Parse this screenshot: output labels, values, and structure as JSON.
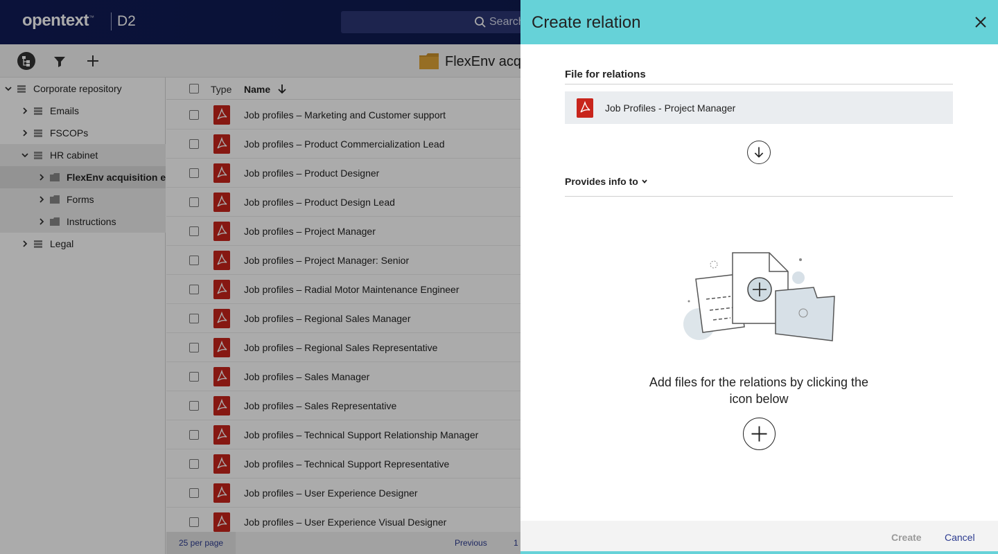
{
  "header": {
    "brand": "opentext",
    "brand_tm": "™",
    "product": "D2",
    "search_placeholder": "Search"
  },
  "toolbar": {
    "current_folder": "FlexEnv acq"
  },
  "sidebar": {
    "items": [
      {
        "label": "Corporate repository"
      },
      {
        "label": "Emails"
      },
      {
        "label": "FSCOPs"
      },
      {
        "label": "HR cabinet"
      },
      {
        "label": "FlexEnv acquisition exp"
      },
      {
        "label": "Forms"
      },
      {
        "label": "Instructions"
      },
      {
        "label": "Legal"
      }
    ]
  },
  "list": {
    "col_type": "Type",
    "col_name": "Name",
    "rows": [
      "Job profiles – Marketing and Customer support",
      "Job profiles – Product Commercialization Lead",
      "Job profiles – Product Designer",
      "Job profiles – Product Design Lead",
      "Job profiles – Project Manager",
      "Job profiles – Project Manager: Senior",
      "Job profiles – Radial Motor Maintenance Engineer",
      "Job profiles – Regional Sales Manager",
      "Job profiles – Regional Sales Representative",
      "Job profiles – Sales Manager",
      "Job profiles – Sales Representative",
      "Job profiles – Technical Support Relationship Manager",
      "Job profiles – Technical Support Representative",
      "Job profiles – User Experience Designer",
      "Job profiles – User Experience Visual Designer"
    ],
    "per_page": "25 per page",
    "previous": "Previous",
    "page": "1"
  },
  "panel": {
    "title": "Create relation",
    "file_section": "File for relations",
    "file_name": "Job Profiles - Project Manager",
    "relation_type": "Provides info to",
    "empty_message": "Add files for the relations by clicking the icon below",
    "create_label": "Create",
    "cancel_label": "Cancel",
    "accent_color": "#66d2d8"
  }
}
